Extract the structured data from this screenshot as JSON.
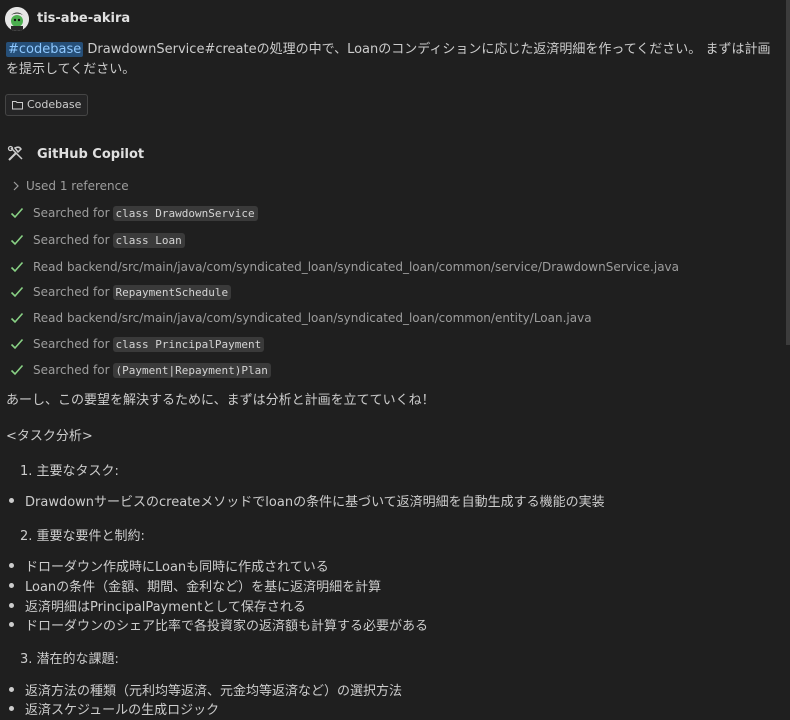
{
  "user": {
    "name": "tis-abe-akira"
  },
  "prompt": {
    "tag": "#codebase",
    "text": " DrawdownService#createの処理の中で、Loanのコンディションに応じた返済明細を作ってください。 まずは計画を提示してください。"
  },
  "reference_chip": {
    "label": "Codebase"
  },
  "assistant": {
    "name": "GitHub Copilot",
    "used_reference": "Used 1 reference",
    "steps": [
      {
        "text": "Searched for",
        "code": "class DrawdownService"
      },
      {
        "text": "Searched for",
        "code": "class Loan"
      },
      {
        "text": "Read backend/src/main/java/com/syndicated_loan/syndicated_loan/common/service/DrawdownService.java",
        "code": ""
      },
      {
        "text": "Searched for",
        "code": "RepaymentSchedule"
      },
      {
        "text": "Read backend/src/main/java/com/syndicated_loan/syndicated_loan/common/entity/Loan.java",
        "code": ""
      },
      {
        "text": "Searched for",
        "code": "class PrincipalPayment"
      },
      {
        "text": "Searched for",
        "code": "(Payment|Repayment)Plan"
      }
    ],
    "intro": "あーし、この要望を解決するために、まずは分析と計画を立てていくね！",
    "task_analysis": "<タスク分析>",
    "sections": [
      {
        "heading": "1. 主要なタスク:",
        "bullets": [
          "Drawdownサービスのcreateメソッドでloanの条件に基づいて返済明細を自動生成する機能の実装"
        ]
      },
      {
        "heading": "2. 重要な要件と制約:",
        "bullets": [
          "ドローダウン作成時にLoanも同時に作成されている",
          "Loanの条件（金額、期間、金利など）を基に返済明細を計算",
          "返済明細はPrincipalPaymentとして保存される",
          "ドローダウンのシェア比率で各投資家の返済額も計算する必要がある"
        ]
      },
      {
        "heading": "3. 潜在的な課題:",
        "bullets": [
          "返済方法の種類（元利均等返済、元金均等返済など）の選択方法",
          "返済スケジュールの生成ロジック"
        ]
      }
    ]
  },
  "colors": {
    "background": "#1f1f1f",
    "text": "#cccccc",
    "tag_bg": "#264f78",
    "check": "#89d185"
  }
}
